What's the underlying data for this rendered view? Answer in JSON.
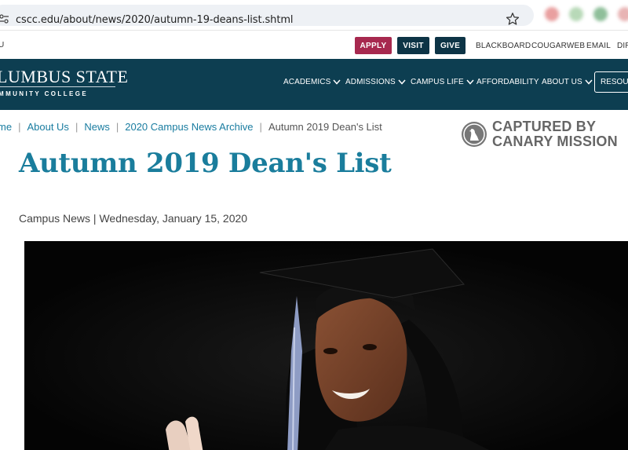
{
  "browser": {
    "url": "cscc.edu/about/news/2020/autumn-19-deans-list.shtml"
  },
  "utility": {
    "cut_text": "U",
    "buttons": {
      "apply": "APPLY",
      "visit": "VISIT",
      "give": "GIVE"
    },
    "links": [
      "BLACKBOARD",
      "COUGARWEB",
      "EMAIL",
      "DIR"
    ],
    "colors": {
      "apply": "#a7294f",
      "dark": "#0d3446"
    }
  },
  "nav": {
    "logo_main": "LUMBUS STATE",
    "logo_sub": "MMUNITY COLLEGE",
    "items": [
      "ACADEMICS",
      "ADMISSIONS",
      "CAMPUS LIFE",
      "AFFORDABILITY",
      "ABOUT US"
    ],
    "resources": "RESOUR",
    "background": "#0d3e51"
  },
  "breadcrumb": {
    "items": [
      "me",
      "About Us",
      "News",
      "2020 Campus News Archive"
    ],
    "current": "Autumn 2019 Dean's List"
  },
  "watermark": {
    "line1": "CAPTURED BY",
    "line2": "CANARY MISSION"
  },
  "article": {
    "title": "Autumn 2019 Dean's List",
    "category": "Campus News",
    "separator": "|",
    "date": "Wednesday, January 15, 2020",
    "hero_description_icon": "graduate-photo"
  }
}
